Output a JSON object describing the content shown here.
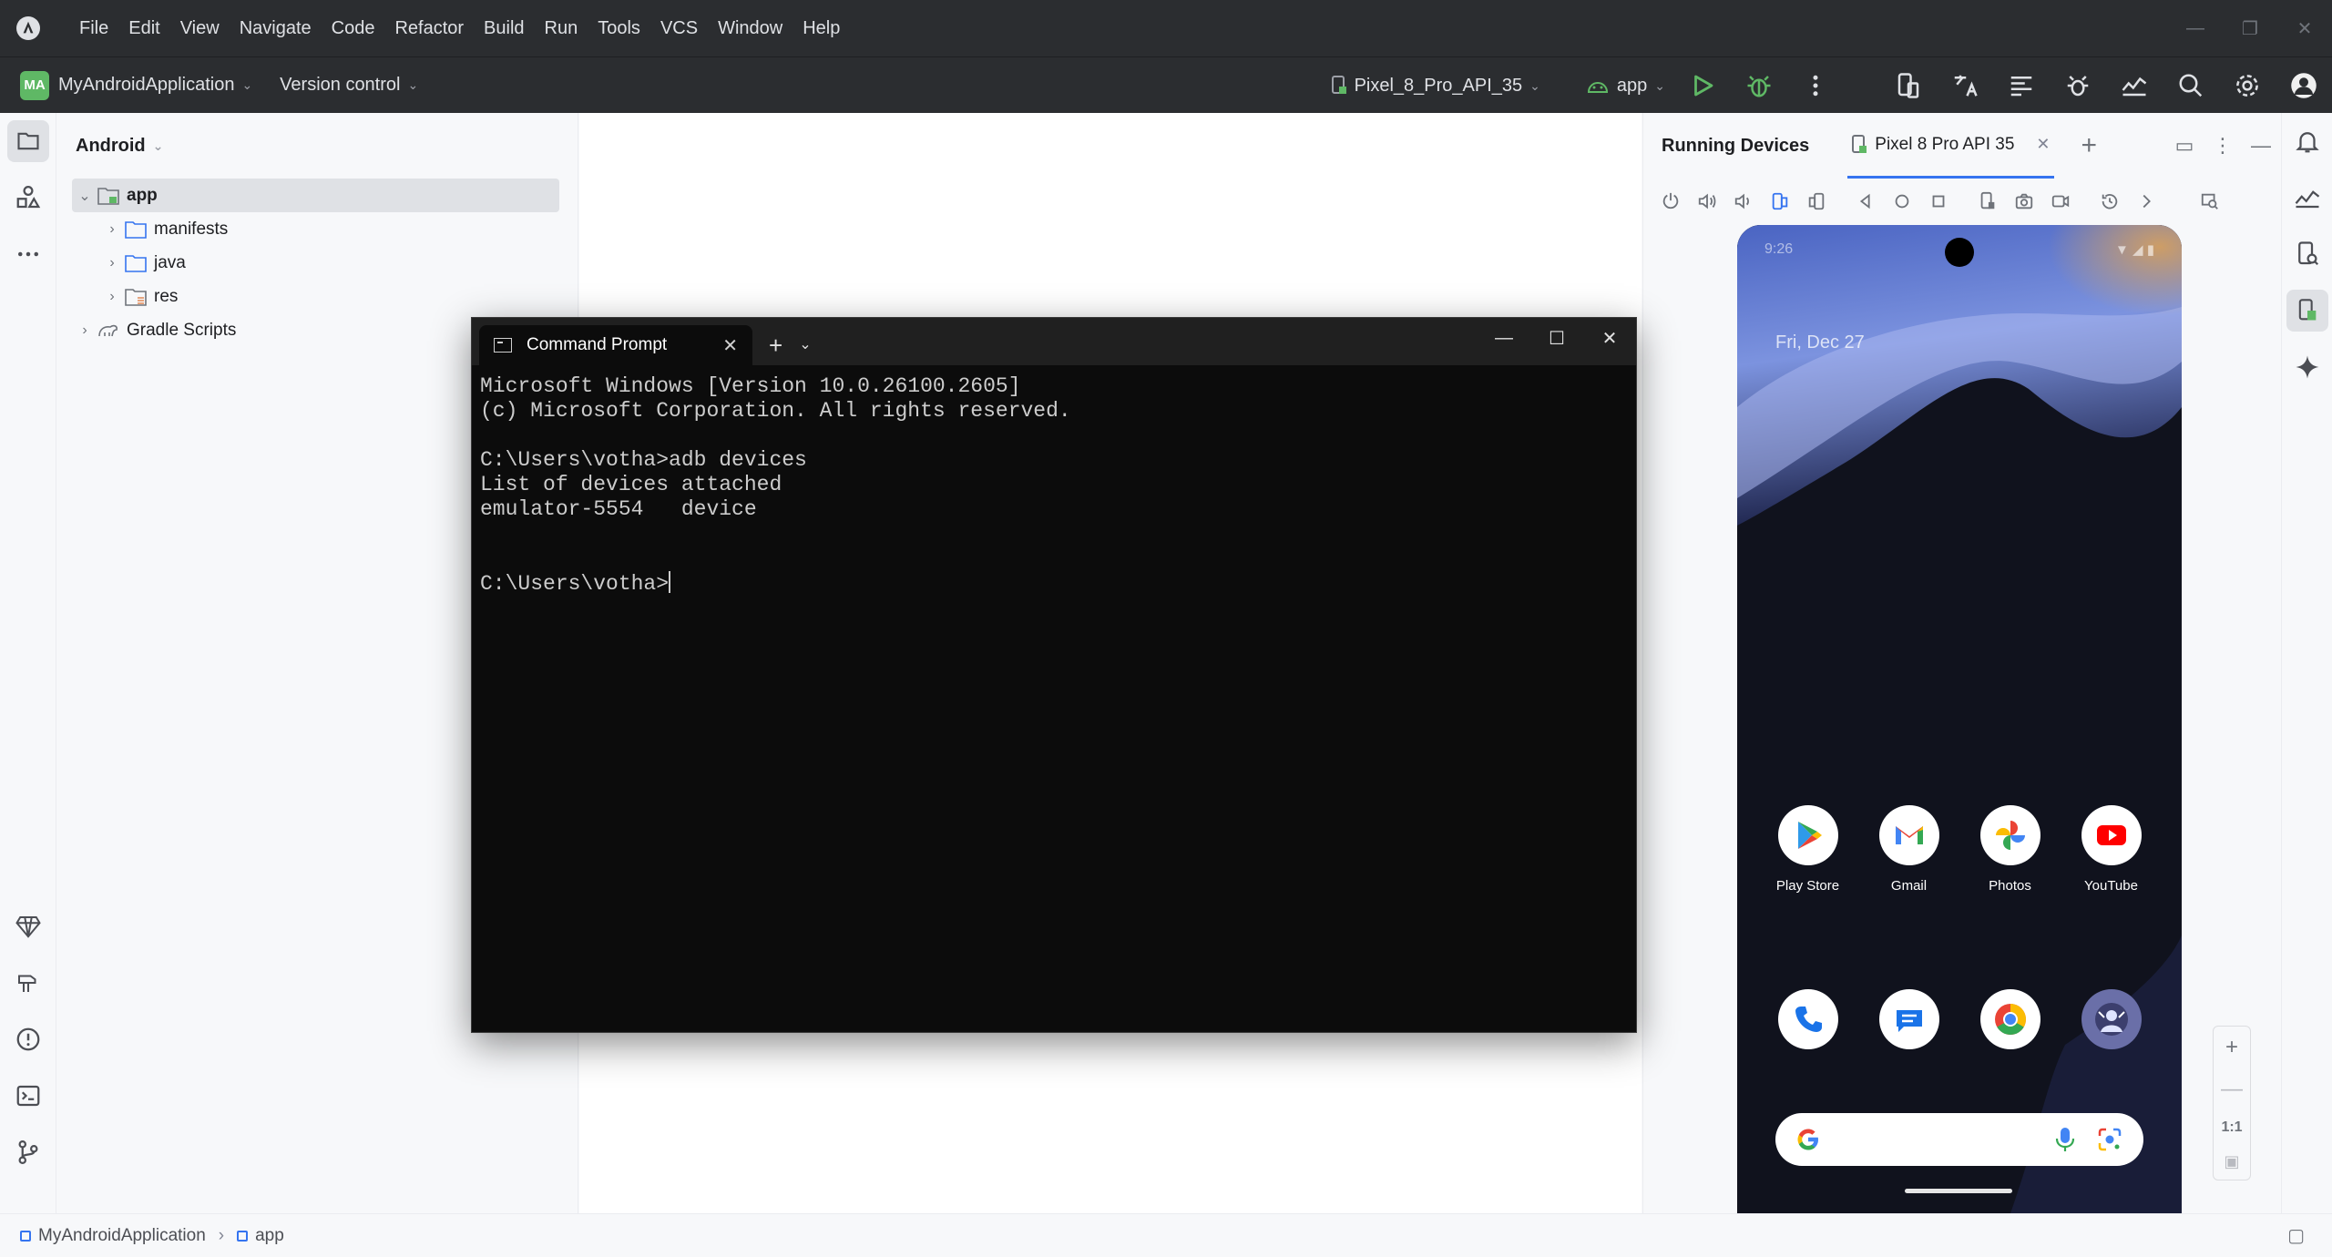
{
  "menu": [
    "File",
    "Edit",
    "View",
    "Navigate",
    "Code",
    "Refactor",
    "Build",
    "Run",
    "Tools",
    "VCS",
    "Window",
    "Help"
  ],
  "toolbar": {
    "project_badge": "MA",
    "project_name": "MyAndroidApplication",
    "version_control": "Version control",
    "device_selector": "Pixel_8_Pro_API_35",
    "run_config": "app"
  },
  "project_panel": {
    "view_mode": "Android",
    "tree": [
      {
        "label": "app"
      },
      {
        "label": "manifests"
      },
      {
        "label": "java"
      },
      {
        "label": "res"
      },
      {
        "label": "Gradle Scripts"
      }
    ]
  },
  "devices": {
    "title": "Running Devices",
    "tab_label": "Pixel 8 Pro API 35",
    "zoom_label": "1:1",
    "phone": {
      "time": "9:26",
      "date": "Fri, Dec 27",
      "apps_row1": [
        {
          "label": "Play Store",
          "icon": "play-store-icon"
        },
        {
          "label": "Gmail",
          "icon": "gmail-icon"
        },
        {
          "label": "Photos",
          "icon": "photos-icon"
        },
        {
          "label": "YouTube",
          "icon": "youtube-icon"
        }
      ],
      "dock": [
        "phone-icon",
        "messages-icon",
        "chrome-icon",
        "game-avatar-icon"
      ]
    }
  },
  "statusbar": {
    "crumb1": "MyAndroidApplication",
    "crumb2": "app"
  },
  "cmd": {
    "tab_title": "Command Prompt",
    "lines": [
      "Microsoft Windows [Version 10.0.26100.2605]",
      "(c) Microsoft Corporation. All rights reserved.",
      "",
      "C:\\Users\\votha>adb devices",
      "List of devices attached",
      "emulator-5554   device",
      "",
      ""
    ],
    "prompt": "C:\\Users\\votha>"
  },
  "colors": {
    "accent": "#3574f0",
    "toolbar_bg": "#2b2d30",
    "run_green": "#5fb865",
    "terminal_bg": "#0c0c0c"
  }
}
